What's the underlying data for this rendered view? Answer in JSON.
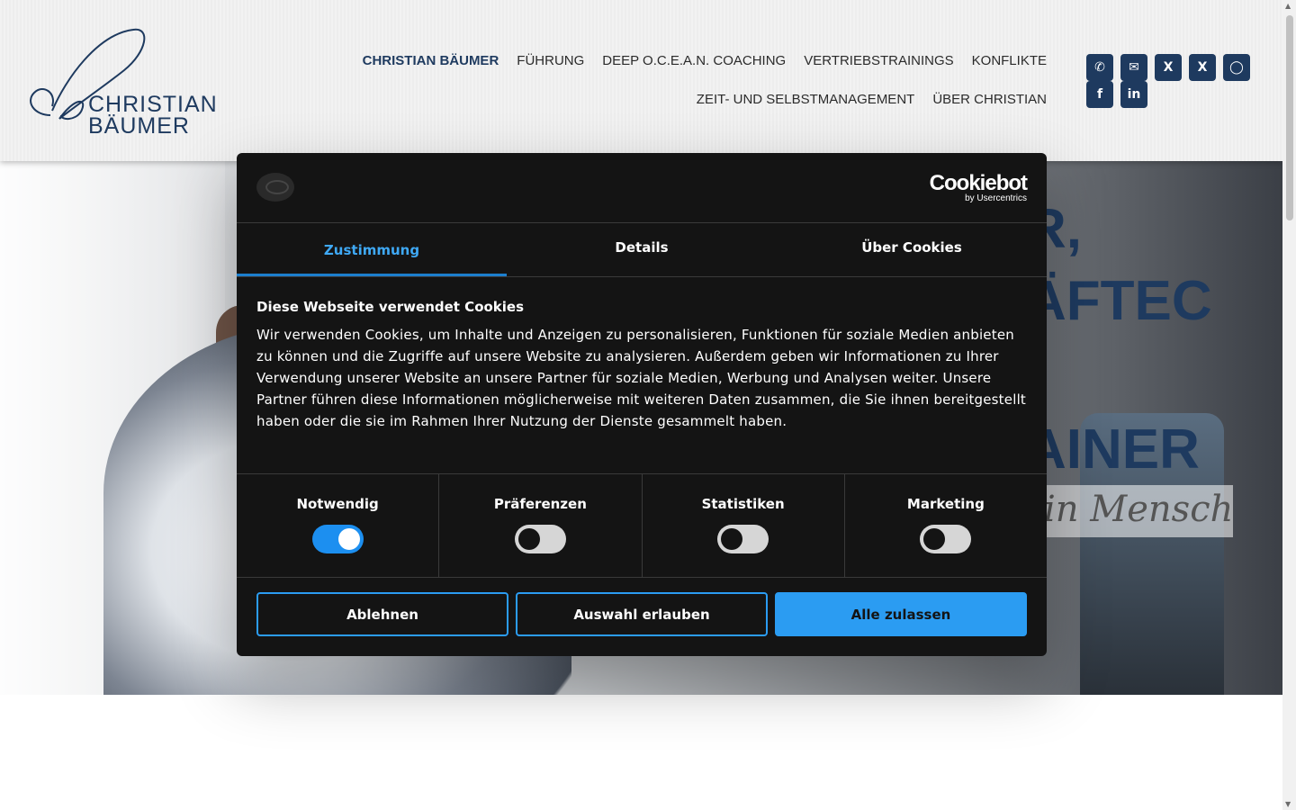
{
  "header": {
    "logo_line1": "CHRISTIAN",
    "logo_line2": "BÄUMER",
    "nav_row1": [
      "CHRISTIAN BÄUMER",
      "FÜHRUNG",
      "DEEP O.C.E.A.N. COACHING",
      "VERTRIEBSTRAININGS",
      "KONFLIKTE"
    ],
    "nav_row2": [
      "ZEIT- UND SELBSTMANAGEMENT",
      "ÜBER CHRISTIAN"
    ],
    "social": [
      "phone-icon",
      "mail-icon",
      "xing-icon",
      "xing-icon",
      "instagram-icon",
      "facebook-icon",
      "linkedin-icon"
    ]
  },
  "hero": {
    "line1": "R,",
    "line2": "ÄFTEC",
    "line3": "AINER",
    "script": "in Mensch"
  },
  "cookie": {
    "brand": "Cookiebot",
    "brand_sub": "by Usercentrics",
    "tabs": [
      "Zustimmung",
      "Details",
      "Über Cookies"
    ],
    "title": "Diese Webseite verwendet Cookies",
    "text": "Wir verwenden Cookies, um Inhalte und Anzeigen zu personalisieren, Funktionen für soziale Medien anbieten zu können und die Zugriffe auf unsere Website zu analysieren. Außerdem geben wir Informationen zu Ihrer Verwendung unserer Website an unsere Partner für soziale Medien, Werbung und Analysen weiter. Unsere Partner führen diese Informationen möglicherweise mit weiteren Daten zusammen, die Sie ihnen bereitgestellt haben oder die sie im Rahmen Ihrer Nutzung der Dienste gesammelt haben.",
    "toggles": [
      {
        "label": "Notwendig",
        "on": true
      },
      {
        "label": "Präferenzen",
        "on": false
      },
      {
        "label": "Statistiken",
        "on": false
      },
      {
        "label": "Marketing",
        "on": false
      }
    ],
    "buttons": {
      "decline": "Ablehnen",
      "allow_selection": "Auswahl erlauben",
      "allow_all": "Alle zulassen"
    }
  },
  "colors": {
    "brand_navy": "#1e3a5f",
    "cookie_bg": "#141414",
    "cookie_accent": "#2b9cf2"
  }
}
